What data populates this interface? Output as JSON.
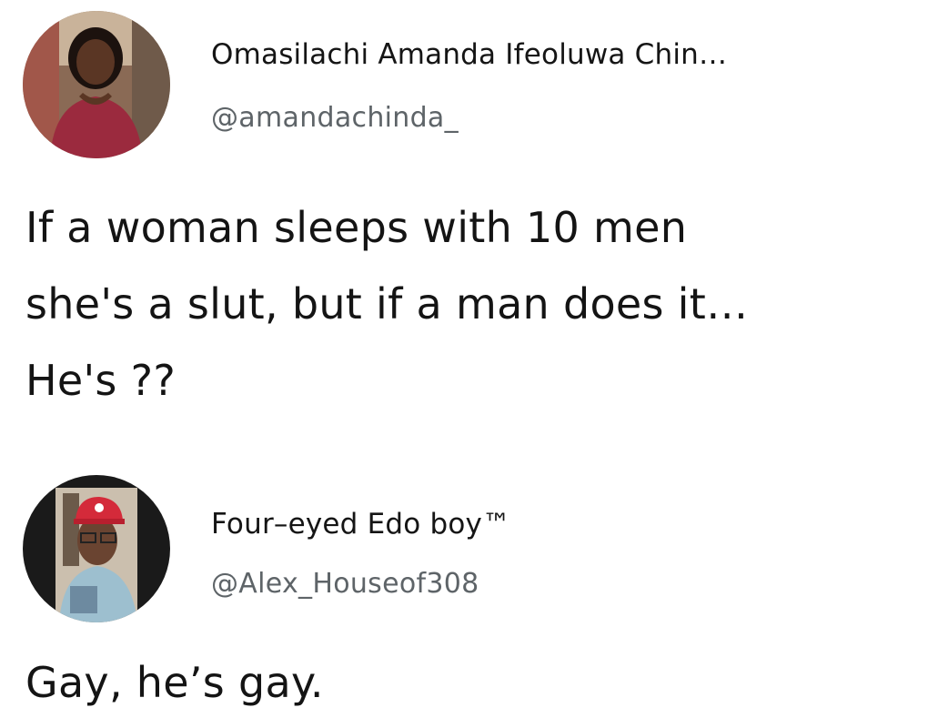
{
  "tweets": [
    {
      "avatar_icon": "user-photo-woman",
      "display_name": "Omasilachi Amanda Ifeoluwa Chin…",
      "handle": "@amandachinda_",
      "text_lines": [
        "If a woman sleeps with 10 men",
        "she's a slut, but if a man does it…",
        "He's ??"
      ]
    },
    {
      "avatar_icon": "user-photo-man-red-cap",
      "display_name": "Four–eyed Edo boy™",
      "handle": "@Alex_Houseof308",
      "text_lines": [
        "Gay, he’s gay."
      ]
    }
  ]
}
